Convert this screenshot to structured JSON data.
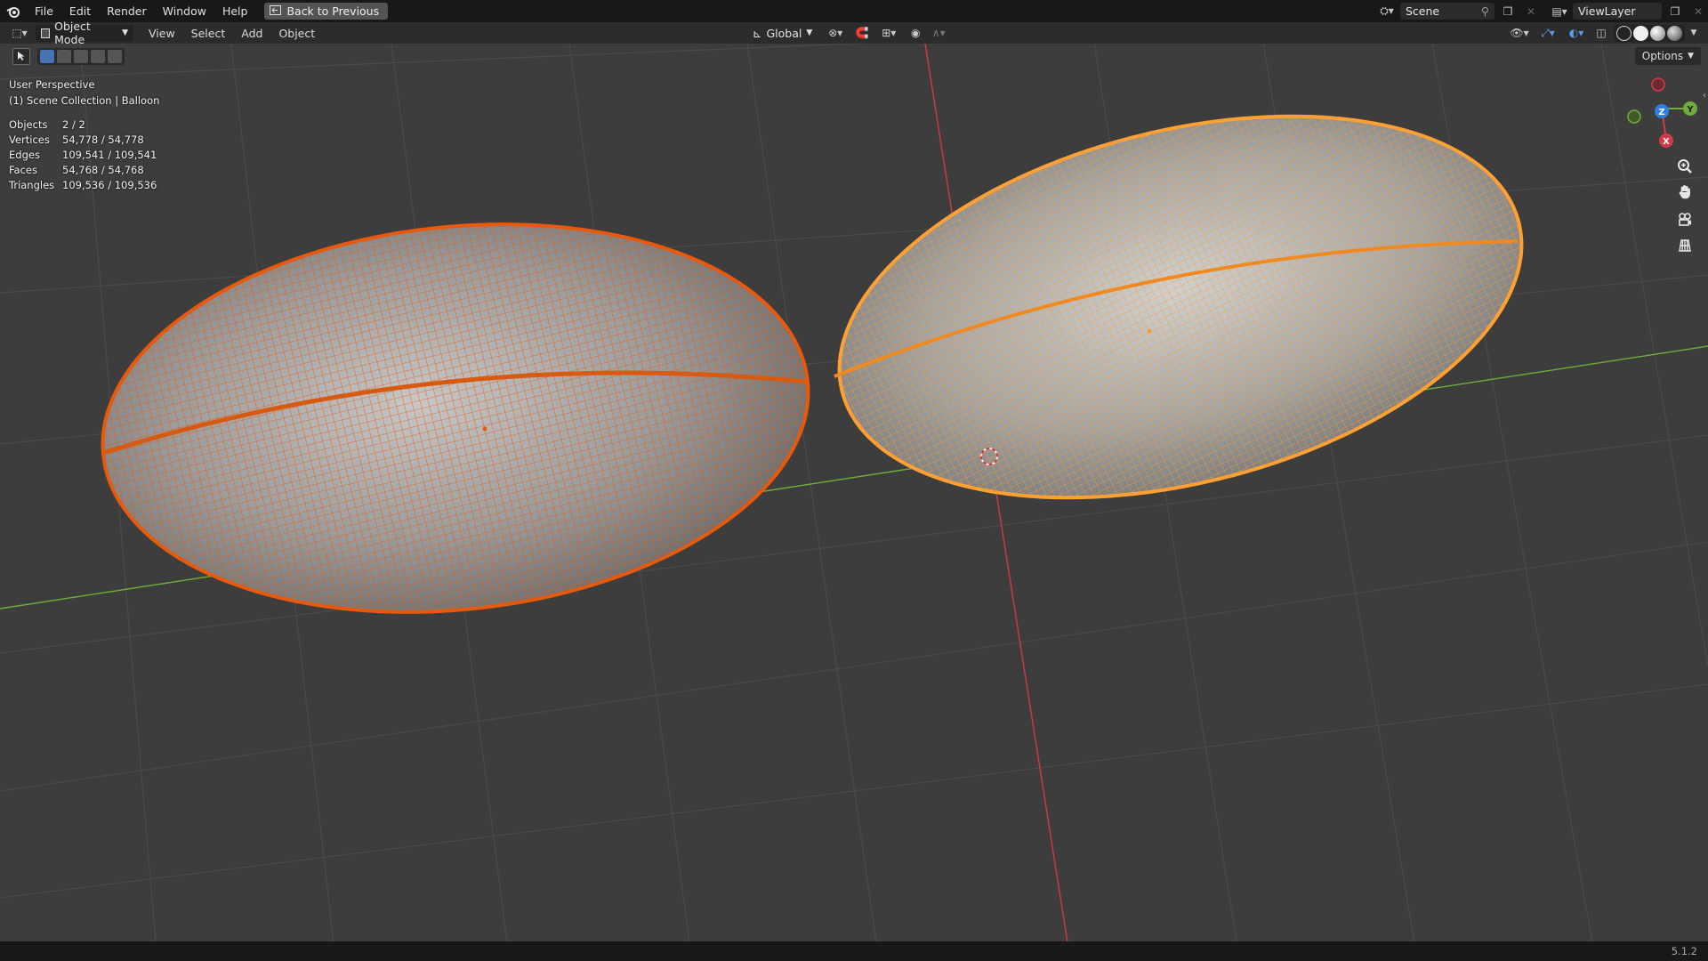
{
  "topbar": {
    "menus": [
      "File",
      "Edit",
      "Render",
      "Window",
      "Help"
    ],
    "back_button": "Back to Previous",
    "scene": "Scene",
    "view_layer": "ViewLayer"
  },
  "header": {
    "mode": "Object Mode",
    "menus": [
      "View",
      "Select",
      "Add",
      "Object"
    ],
    "orientation": "Global",
    "options": "Options"
  },
  "overlay": {
    "perspective": "User Perspective",
    "collection": "(1) Scene Collection | Balloon",
    "stats": [
      {
        "label": "Objects",
        "value": "2 / 2"
      },
      {
        "label": "Vertices",
        "value": "54,778 / 54,778"
      },
      {
        "label": "Edges",
        "value": "109,541 / 109,541"
      },
      {
        "label": "Faces",
        "value": "54,768 / 54,768"
      },
      {
        "label": "Triangles",
        "value": "109,536 / 109,536"
      }
    ]
  },
  "gizmo": {
    "z": "Z",
    "y": "Y",
    "x": "X"
  },
  "colors": {
    "selected_dark": "#e8590c",
    "selected_active": "#ff9a2a",
    "x_axis": "#d23a4a",
    "y_axis": "#6fae3a",
    "z_axis": "#2f7fe0",
    "grid": "#4a4a4a",
    "background": "#3d3d3d"
  },
  "status": {
    "version": "5.1.2"
  }
}
